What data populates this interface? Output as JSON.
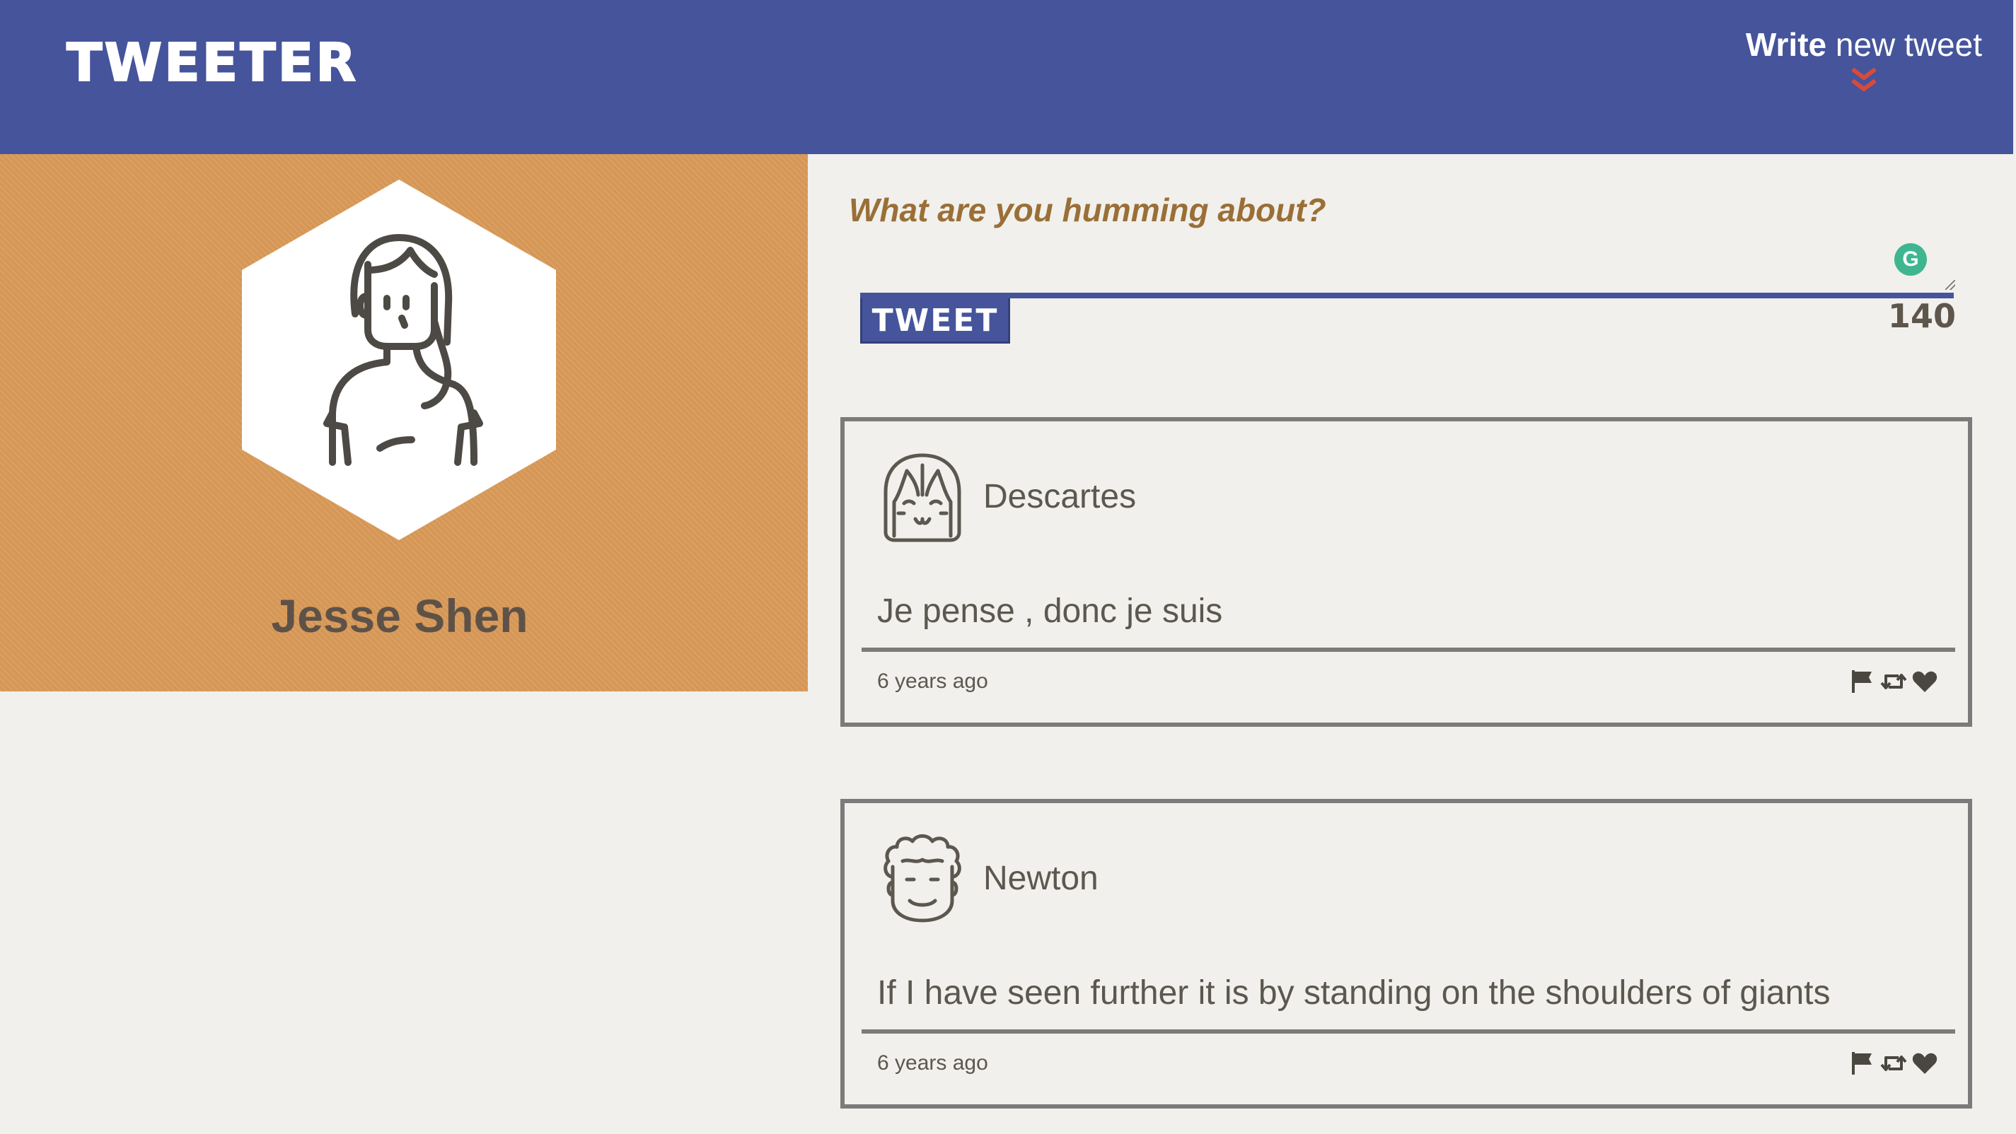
{
  "header": {
    "logo": "TWEETER",
    "compose_toggle_bold": "Write",
    "compose_toggle_rest": " new tweet",
    "compose_toggle_icon": "double-chevron-down",
    "colors": {
      "bar": "#45549b",
      "chevron": "#d94a3a"
    }
  },
  "profile": {
    "name": "Jesse Shen",
    "avatar_icon": "girl-avatar",
    "colors": {
      "panel": "#d99a58",
      "hexagon": "#ffffff"
    }
  },
  "compose": {
    "prompt": "What are you humming about?",
    "value": "",
    "button_label": "TWEET",
    "counter": "140",
    "extension_icon": "grammarly-icon"
  },
  "tweets": [
    {
      "author": "Descartes",
      "avatar_icon": "smiling-girl-avatar",
      "content": "Je pense , donc je suis",
      "time": "6 years ago",
      "actions": [
        "flag-icon",
        "retweet-icon",
        "heart-icon"
      ]
    },
    {
      "author": "Newton",
      "avatar_icon": "curly-hair-avatar",
      "content": "If I have seen further it is by standing on the shoulders of giants",
      "time": "6 years ago",
      "actions": [
        "flag-icon",
        "retweet-icon",
        "heart-icon"
      ]
    }
  ]
}
